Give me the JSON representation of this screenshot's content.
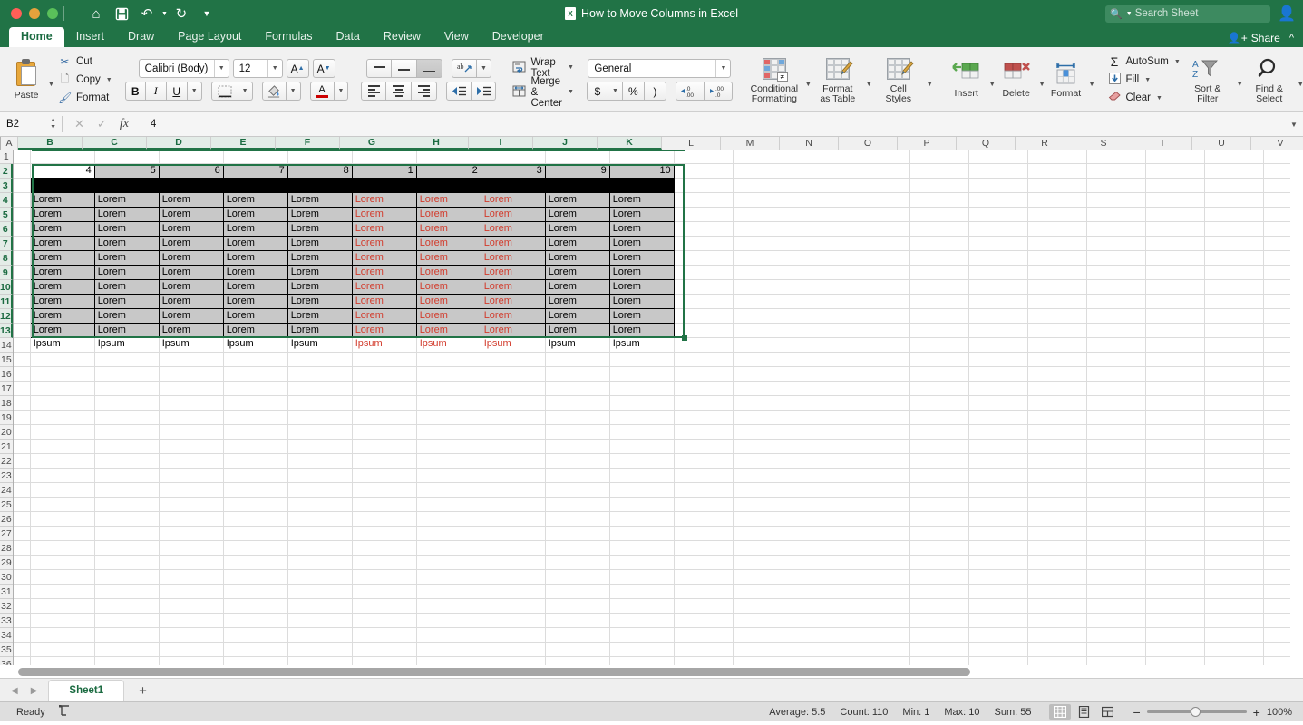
{
  "titlebar": {
    "document_title": "How to Move Columns in Excel",
    "search_placeholder": "Search Sheet",
    "quick_access": [
      {
        "name": "home-icon",
        "glyph": "⌂"
      },
      {
        "name": "save-icon",
        "glyph": "💾"
      },
      {
        "name": "undo-icon",
        "glyph": "↶"
      },
      {
        "name": "redo-icon",
        "glyph": "↻"
      },
      {
        "name": "customize-toolbar-icon",
        "glyph": "▾"
      }
    ]
  },
  "tabs": {
    "items": [
      "Home",
      "Insert",
      "Draw",
      "Page Layout",
      "Formulas",
      "Data",
      "Review",
      "View",
      "Developer"
    ],
    "active": "Home",
    "share_label": "Share"
  },
  "ribbon": {
    "clipboard": {
      "paste_label": "Paste",
      "cut_label": "Cut",
      "copy_label": "Copy",
      "format_label": "Format"
    },
    "font": {
      "family": "Calibri (Body)",
      "size": "12",
      "grow_label": "A",
      "shrink_label": "A",
      "bold_label": "B",
      "italic_label": "I",
      "underline_label": "U",
      "fill_color_label": "A",
      "font_color_accent": "#cc0000"
    },
    "alignment": {
      "wrap_text_label": "Wrap Text",
      "merge_center_label": "Merge & Center",
      "orientation_label": "ab"
    },
    "number": {
      "format": "General",
      "currency_label": "$",
      "percent_label": "%",
      "comma_label": ")",
      "increase_decimal_label": ".00",
      "decrease_decimal_label": ".00"
    },
    "styles": [
      {
        "label_line1": "Conditional",
        "label_line2": "Formatting",
        "name": "conditional-formatting-button"
      },
      {
        "label_line1": "Format",
        "label_line2": "as Table",
        "name": "format-as-table-button"
      },
      {
        "label_line1": "Cell",
        "label_line2": "Styles",
        "name": "cell-styles-button"
      }
    ],
    "cells": [
      {
        "label_line1": "Insert",
        "label_line2": "",
        "name": "insert-cells-button"
      },
      {
        "label_line1": "Delete",
        "label_line2": "",
        "name": "delete-cells-button"
      },
      {
        "label_line1": "Format",
        "label_line2": "",
        "name": "format-cells-button"
      }
    ],
    "editing": {
      "autosum_label": "AutoSum",
      "fill_label": "Fill",
      "clear_label": "Clear",
      "sort_filter_line1": "Sort &",
      "sort_filter_line2": "Filter",
      "find_select_line1": "Find &",
      "find_select_line2": "Select"
    }
  },
  "formula_bar": {
    "name_box": "B2",
    "formula_value": "4",
    "cancel_icon": "✕",
    "enter_icon": "✓",
    "fx_label": "fx"
  },
  "grid": {
    "column_headers": [
      "A",
      "B",
      "C",
      "D",
      "E",
      "F",
      "G",
      "H",
      "I",
      "J",
      "K",
      "L",
      "M",
      "N",
      "O",
      "P",
      "Q",
      "R",
      "S",
      "T",
      "U",
      "V"
    ],
    "selected_columns": [
      "B",
      "C",
      "D",
      "E",
      "F",
      "G",
      "H",
      "I",
      "J",
      "K"
    ],
    "row_headers": [
      1,
      2,
      3,
      4,
      5,
      6,
      7,
      8,
      9,
      10,
      11,
      12,
      13,
      14,
      15,
      16,
      17,
      18,
      19,
      20,
      21,
      22,
      23,
      24,
      25,
      26,
      27,
      28,
      29,
      30,
      31,
      32,
      33,
      34,
      35,
      36
    ],
    "selected_rows": [
      2,
      3,
      4,
      5,
      6,
      7,
      8,
      9,
      10,
      11,
      12,
      13
    ],
    "active_cell": "B2",
    "selection_range": "B2:K13",
    "header_row": {
      "row": 2,
      "values": [
        "4",
        "5",
        "6",
        "7",
        "8",
        "1",
        "2",
        "3",
        "9",
        "10"
      ]
    },
    "divider_row": {
      "row": 3,
      "fill_color": "#000000"
    },
    "data_text": "Lorem Ipsum",
    "data_rows": [
      4,
      5,
      6,
      7,
      8,
      9,
      10,
      11,
      12,
      13
    ],
    "red_text_columns": [
      "G",
      "H",
      "I"
    ],
    "red_text_color": "#d23b2c",
    "selection_accent": "#217346"
  },
  "sheet_tabs": {
    "sheets": [
      "Sheet1"
    ],
    "active": "Sheet1",
    "add_label": "+"
  },
  "status_bar": {
    "ready_label": "Ready",
    "average": "Average: 5.5",
    "count": "Count: 110",
    "min": "Min: 1",
    "max": "Max: 10",
    "sum": "Sum: 55",
    "zoom": "100%",
    "views": [
      "normal-view",
      "page-layout-view",
      "page-break-view"
    ]
  }
}
